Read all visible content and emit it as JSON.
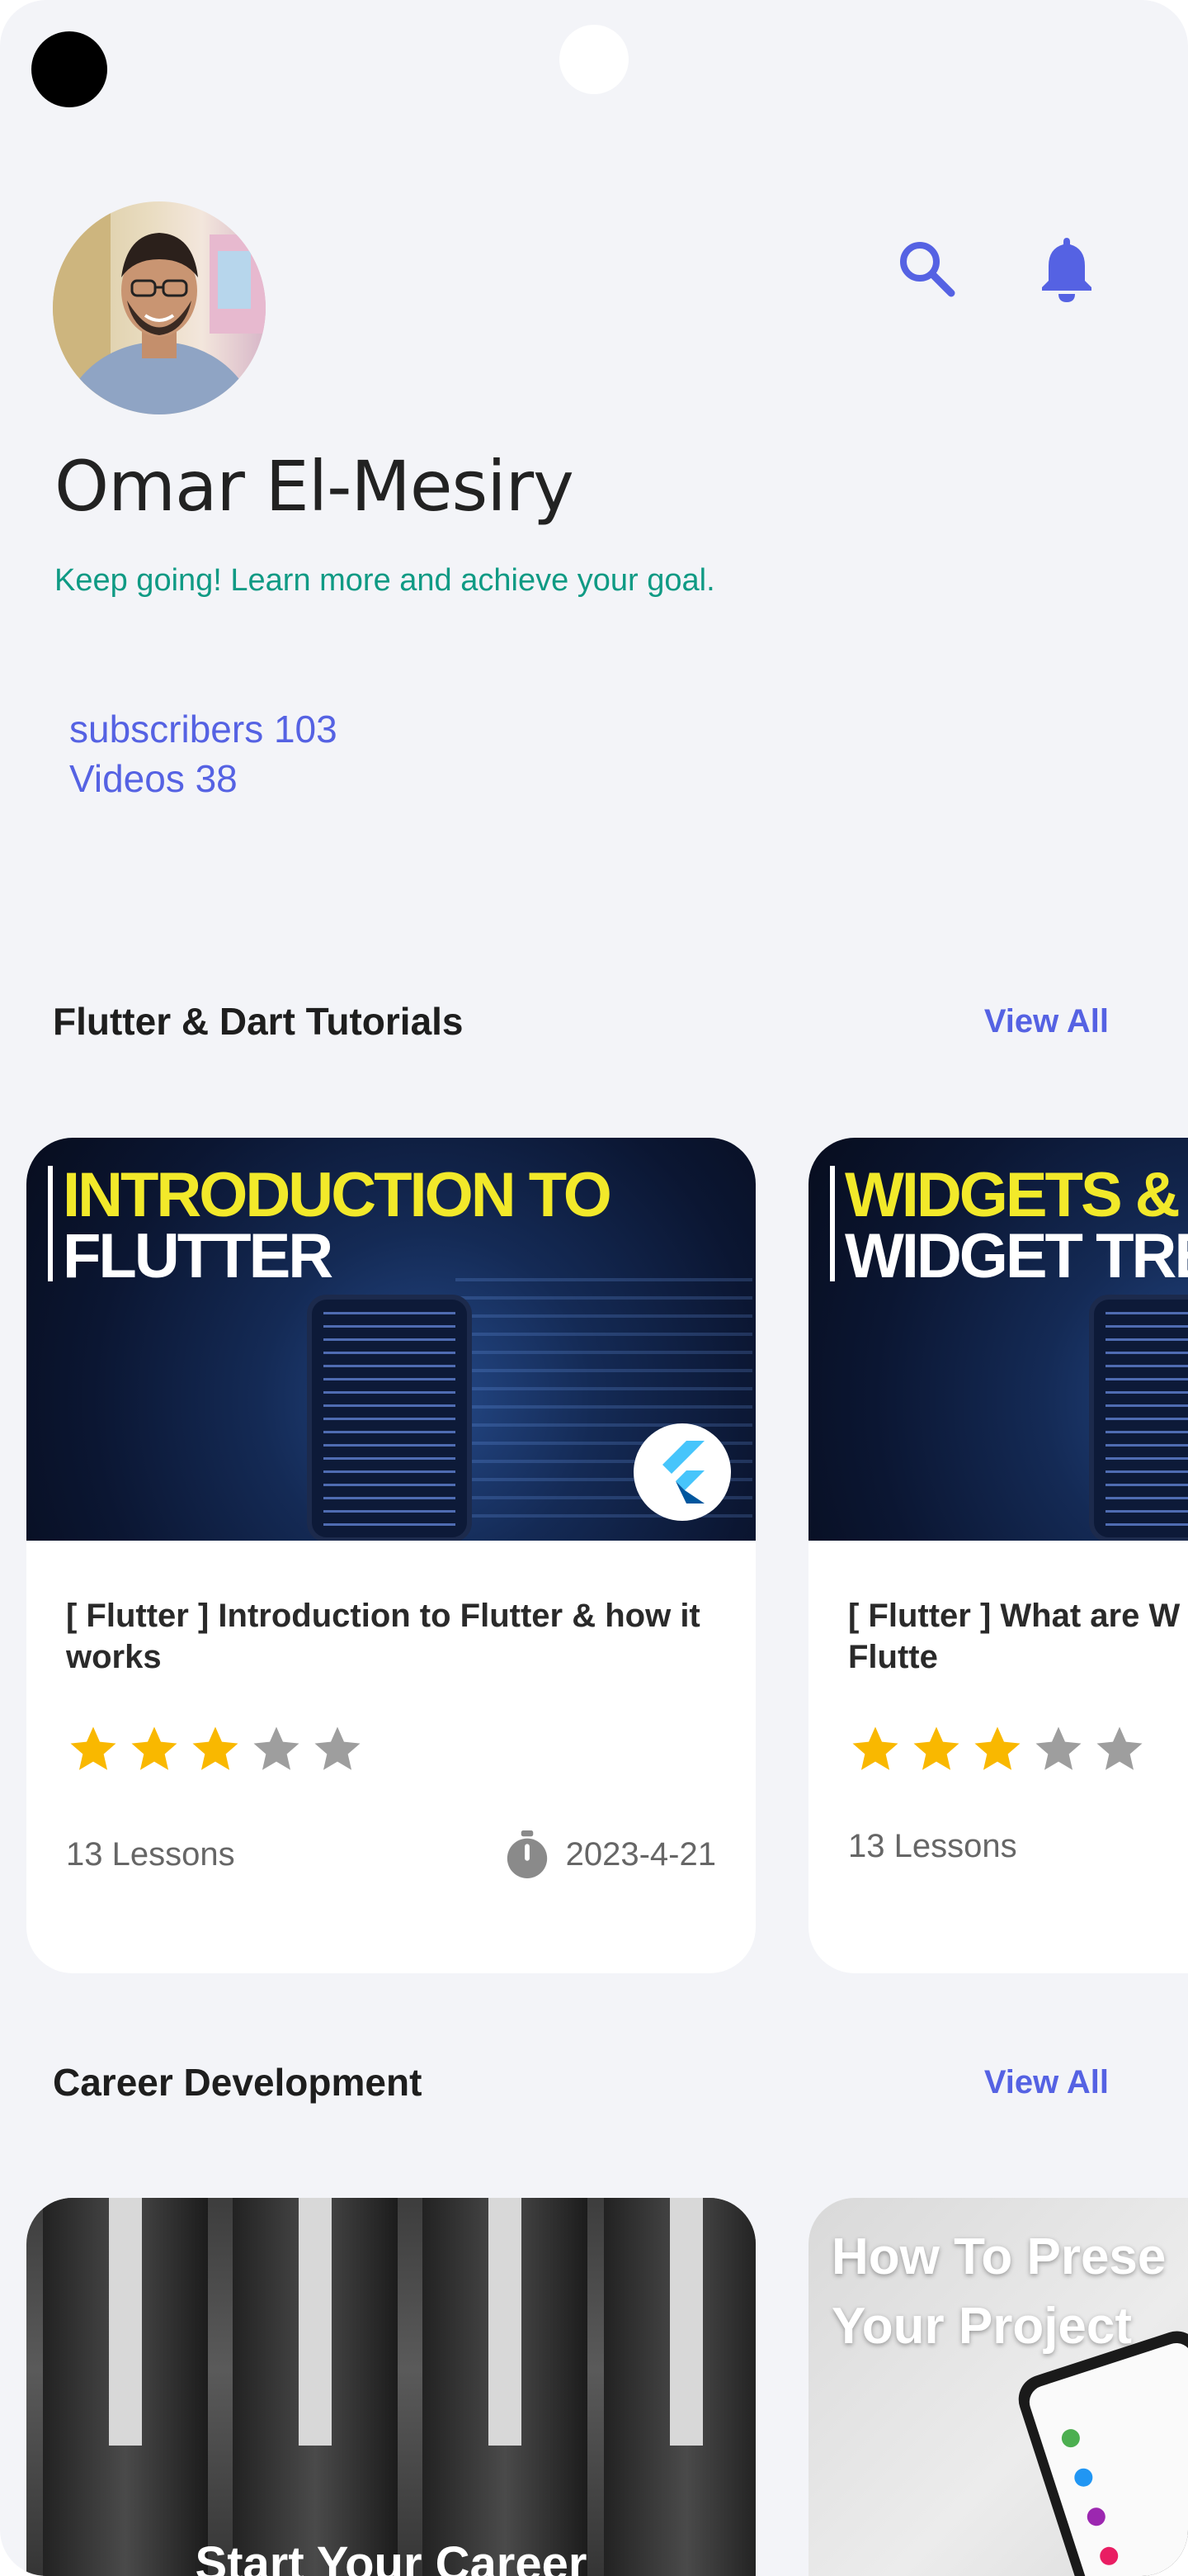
{
  "profile": {
    "name": "Omar El-Mesiry",
    "tagline": "Keep going! Learn more and achieve your goal.",
    "stats": {
      "subscribers": "subscribers 103",
      "videos": "Videos 38"
    }
  },
  "icons": {
    "search": "search-icon",
    "notifications": "bell-icon"
  },
  "colors": {
    "accent": "#5562e3",
    "tagline": "#0f9a84",
    "star_filled": "#f9b800",
    "star_empty": "#9e9e9e",
    "background": "#f3f4f8"
  },
  "sections": [
    {
      "title": "Flutter & Dart Tutorials",
      "view_all": "View All",
      "cards": [
        {
          "thumb_line1": "INTRODUCTION TO",
          "thumb_line2": "FLUTTER",
          "title": "[ Flutter ] Introduction to Flutter & how it works",
          "rating": 3,
          "rating_max": 5,
          "lessons": "13 Lessons",
          "date": "2023-4-21"
        },
        {
          "thumb_line1": "WIDGETS &",
          "thumb_line2": "WIDGET TRE",
          "title": "[ Flutter ] What are W Widget Tree in Flutte",
          "rating": 3,
          "rating_max": 5,
          "lessons": "13 Lessons",
          "date": ""
        }
      ]
    },
    {
      "title": "Career Development",
      "view_all": "View All",
      "cards": [
        {
          "thumb_text": "Start Your Career"
        },
        {
          "thumb_line1": "How To Prese",
          "thumb_line2": "Your Project"
        }
      ]
    }
  ]
}
